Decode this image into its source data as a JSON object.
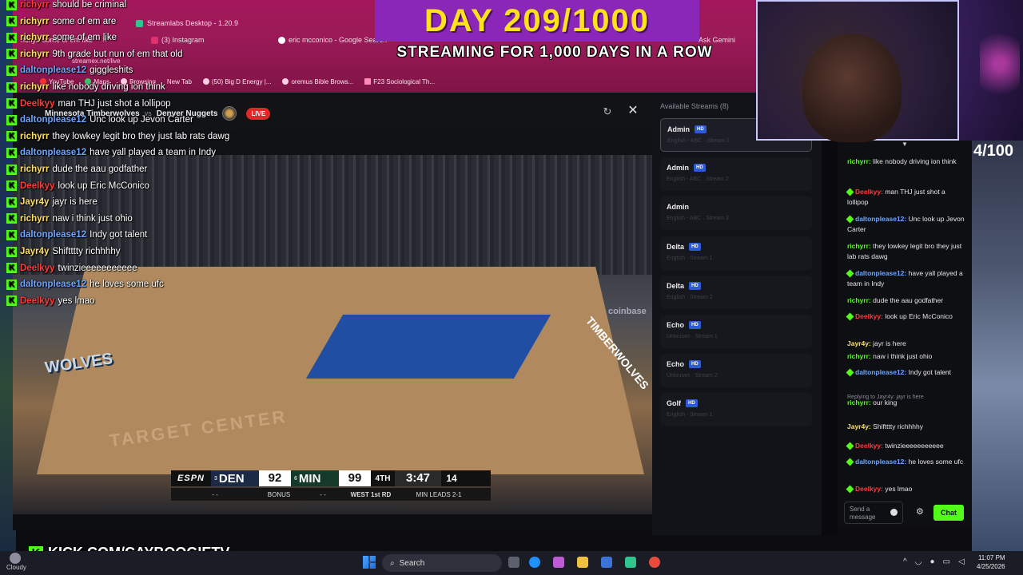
{
  "browser": {
    "window_title": "Streamlabs Desktop - 1.20.9",
    "tabs": [
      {
        "label": "richyr: some of em like",
        "close": "×"
      },
      {
        "label": "(3) Instagram",
        "close": "×"
      },
      {
        "label": "eric mcconico - Google Search"
      },
      {
        "label": "Ask Gemini"
      }
    ],
    "url": "streamex.net/live",
    "bookmarks": [
      "YouTube",
      "Maps",
      "Browsing",
      "New Tab",
      "(50) Big D Energy |...",
      "oremus Bible Brows...",
      "F23 Sociological Th..."
    ]
  },
  "banner": {
    "line1": "DAY 209/1000",
    "line2": "STREAMING FOR 1,000 DAYS IN A ROW"
  },
  "day_counter": "4/100",
  "player": {
    "home_team": "Minnesota Timberwolves",
    "vs": "vs",
    "away_team": "Denver Nuggets",
    "live_label": "LIVE",
    "refresh_icon": "↻",
    "close_icon": "✕",
    "court_text": "TARGET CENTER",
    "logo_text": "WOLVES",
    "sideline_text": "TIMBERWOLVES",
    "sponsor": "coinbase"
  },
  "scorebug": {
    "network": "ESPN",
    "away_seed": "3",
    "away": "DEN",
    "away_score": "92",
    "home_seed": "6",
    "home": "MIN",
    "home_score": "99",
    "quarter": "4TH",
    "clock": "3:47",
    "shot_clock": "14",
    "away_fouls": "- -",
    "bonus": "BONUS",
    "home_fouls": "- -",
    "series": "WEST 1st RD",
    "series_status": "MIN LEADS 2-1"
  },
  "streams": {
    "title": "Available Streams (8)",
    "items": [
      {
        "name": "Admin",
        "hd": "HD",
        "sub": "English - ABC · Stream 1"
      },
      {
        "name": "Admin",
        "hd": "HD",
        "sub": "English - ABC · Stream 2"
      },
      {
        "name": "Admin",
        "hd": "",
        "sub": "English - ABC · Stream 3"
      },
      {
        "name": "Delta",
        "hd": "HD",
        "sub": "English · Stream 1"
      },
      {
        "name": "Delta",
        "hd": "HD",
        "sub": "English · Stream 2"
      },
      {
        "name": "Echo",
        "hd": "HD",
        "sub": "Unknown · Stream 1"
      },
      {
        "name": "Echo",
        "hd": "HD",
        "sub": "Unknown · Stream 2"
      },
      {
        "name": "Golf",
        "hd": "HD",
        "sub": "English · Stream 1"
      }
    ]
  },
  "overlay_chat": [
    {
      "user": "richyrr",
      "color": "#ff3b3b",
      "text": "should be criminal"
    },
    {
      "user": "richyrr",
      "color": "#ffe066",
      "text": "some of em are"
    },
    {
      "user": "richyrr",
      "color": "#ffe066",
      "text": "some of em like"
    },
    {
      "user": "richyrr",
      "color": "#ffe066",
      "text": "9th grade but nun of em that old"
    },
    {
      "user": "daltonplease12",
      "color": "#6ea6ff",
      "text": "giggleshits"
    },
    {
      "user": "richyrr",
      "color": "#ffe066",
      "text": "like nobody driving ion think"
    },
    {
      "user": "Deelkyy",
      "color": "#ff3b3b",
      "text": "man THJ just shot a lollipop"
    },
    {
      "user": "daltonplease12",
      "color": "#6ea6ff",
      "text": "Unc look up Jevon Carter"
    },
    {
      "user": "richyrr",
      "color": "#ffe066",
      "text": "they lowkey legit bro they just lab rats dawg"
    },
    {
      "user": "daltonplease12",
      "color": "#6ea6ff",
      "text": "have yall played a team in Indy"
    },
    {
      "user": "richyrr",
      "color": "#ffe066",
      "text": "dude the aau godfather"
    },
    {
      "user": "Deelkyy",
      "color": "#ff3b3b",
      "text": "look up Eric McConico"
    },
    {
      "user": "Jayr4y",
      "color": "#ffe066",
      "text": "jayr is here"
    },
    {
      "user": "richyrr",
      "color": "#ffe066",
      "text": "naw i think just ohio"
    },
    {
      "user": "daltonplease12",
      "color": "#6ea6ff",
      "text": "Indy got talent"
    },
    {
      "user": "Jayr4y",
      "color": "#ffe066",
      "text": "Shiftttty richhhhy"
    },
    {
      "user": "Deelkyy",
      "color": "#ff3b3b",
      "text": "twinzieeeeeeeeeee"
    },
    {
      "user": "daltonplease12",
      "color": "#6ea6ff",
      "text": "he loves some ufc"
    },
    {
      "user": "Deelkyy",
      "color": "#ff3b3b",
      "text": "yes lmao"
    }
  ],
  "kick_chat": {
    "messages": [
      {
        "user": "richyrr:",
        "color": "#53fc18",
        "text": "like nobody driving ion think",
        "badge": false
      },
      {
        "user": "Deelkyy:",
        "color": "#ff3b3b",
        "text": "man THJ just shot a lollipop",
        "badge": true
      },
      {
        "user": "daltonplease12:",
        "color": "#6ea6ff",
        "text": "Unc look up Jevon Carter",
        "badge": true
      },
      {
        "user": "richyrr:",
        "color": "#53fc18",
        "text": "they lowkey legit bro they just lab rats dawg",
        "badge": false
      },
      {
        "user": "daltonplease12:",
        "color": "#6ea6ff",
        "text": "have yall played a team in Indy",
        "badge": true
      },
      {
        "user": "richyrr:",
        "color": "#53fc18",
        "text": "dude the aau godfather",
        "badge": false
      },
      {
        "user": "Deelkyy:",
        "color": "#ff3b3b",
        "text": "look up Eric McConico",
        "badge": true
      },
      {
        "user": "Jayr4y:",
        "color": "#ffe066",
        "text": "jayr is here",
        "badge": false
      },
      {
        "user": "richyrr:",
        "color": "#53fc18",
        "text": "naw i think just ohio",
        "badge": false
      },
      {
        "user": "daltonplease12:",
        "color": "#6ea6ff",
        "text": "Indy got talent",
        "badge": true
      },
      {
        "user": "richyrr:",
        "color": "#53fc18",
        "text": "our king",
        "badge": false
      },
      {
        "user": "Jayr4y:",
        "color": "#ffe066",
        "text": "Shiftttty richhhhy",
        "badge": false
      },
      {
        "user": "Deelkyy:",
        "color": "#ff3b3b",
        "text": "twinzieeeeeeeeeee",
        "badge": true
      },
      {
        "user": "daltonplease12:",
        "color": "#6ea6ff",
        "text": "he loves some ufc",
        "badge": true
      },
      {
        "user": "Deelkyy:",
        "color": "#ff3b3b",
        "text": "yes lmao",
        "badge": true
      }
    ],
    "reply_note": "Replying to Jayr4y: jayr is here",
    "input_placeholder": "Send a message",
    "chat_button": "Chat"
  },
  "kick_url": "KICK.COM/CAYBOOGIETV",
  "taskbar": {
    "weather": "Cloudy",
    "search_label": "Search",
    "time": "11:07 PM",
    "date": "4/25/2026"
  }
}
